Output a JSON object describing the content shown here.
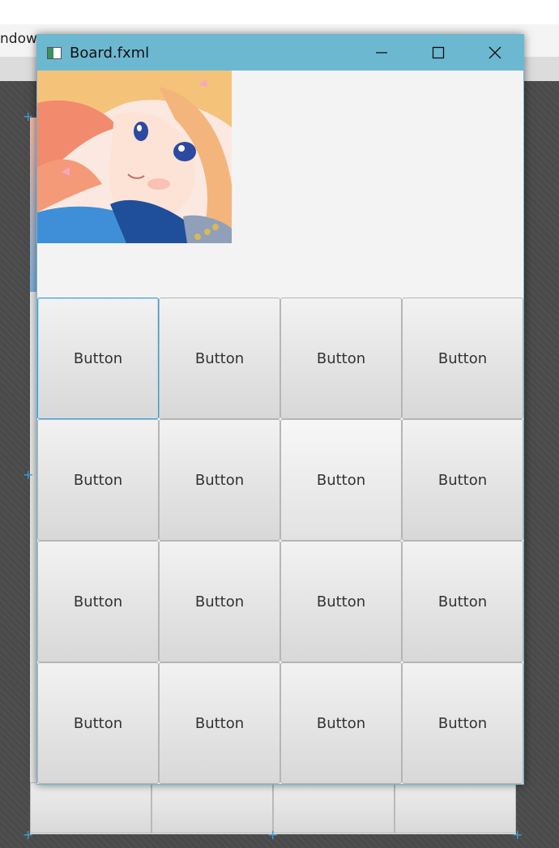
{
  "host": {
    "menu_partial_label": "ndow"
  },
  "window": {
    "title": "Board.fxml",
    "controls": {
      "minimize": "minimize",
      "maximize": "maximize",
      "close": "close"
    }
  },
  "image": {
    "icon": "anime-girl-portrait"
  },
  "grid": {
    "rows": [
      [
        "Button",
        "Button",
        "Button",
        "Button"
      ],
      [
        "Button",
        "Button",
        "Button",
        "Button"
      ],
      [
        "Button",
        "Button",
        "Button",
        "Button"
      ],
      [
        "Button",
        "Button",
        "Button",
        "Button"
      ]
    ]
  },
  "colors": {
    "titlebar": "#6db8d1",
    "focus": "#3a9fd6",
    "workspace": "#4a4a4a"
  }
}
